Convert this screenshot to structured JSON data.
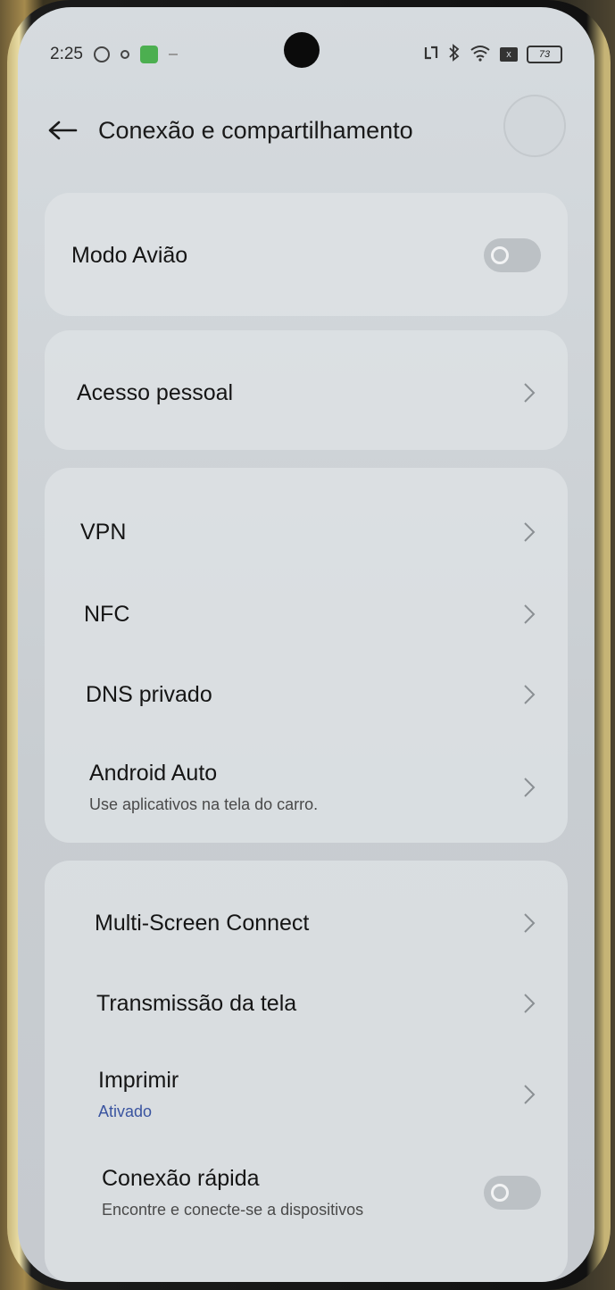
{
  "status_bar": {
    "time": "2:25",
    "battery": "73",
    "icons_left": [
      "vpn-globe-icon",
      "notification-dot-icon",
      "app-green-icon",
      "more-dash-icon"
    ],
    "icons_right": [
      "nfc-icon",
      "bluetooth-icon",
      "wifi-icon",
      "sim-icon",
      "battery-icon"
    ]
  },
  "header": {
    "title": "Conexão e compartilhamento"
  },
  "sections": [
    {
      "items": [
        {
          "label": "Modo Avião",
          "control": "toggle",
          "state": "off"
        }
      ]
    },
    {
      "items": [
        {
          "label": "Acesso pessoal",
          "control": "chevron"
        }
      ]
    },
    {
      "items": [
        {
          "label": "VPN",
          "control": "chevron"
        },
        {
          "label": "NFC",
          "control": "chevron"
        },
        {
          "label": "DNS privado",
          "control": "chevron"
        },
        {
          "label": "Android Auto",
          "sub": "Use aplicativos na tela do carro.",
          "control": "chevron"
        }
      ]
    },
    {
      "items": [
        {
          "label": "Multi-Screen Connect",
          "control": "chevron"
        },
        {
          "label": "Transmissão da tela",
          "control": "chevron"
        },
        {
          "label": "Imprimir",
          "sub": "Ativado",
          "control": "chevron"
        },
        {
          "label": "Conexão rápida",
          "sub": "Encontre e conecte-se a dispositivos",
          "control": "toggle",
          "state": "off"
        }
      ]
    }
  ],
  "colors": {
    "accent_sub": "#3a54a0",
    "background": "#cfd4d8"
  }
}
